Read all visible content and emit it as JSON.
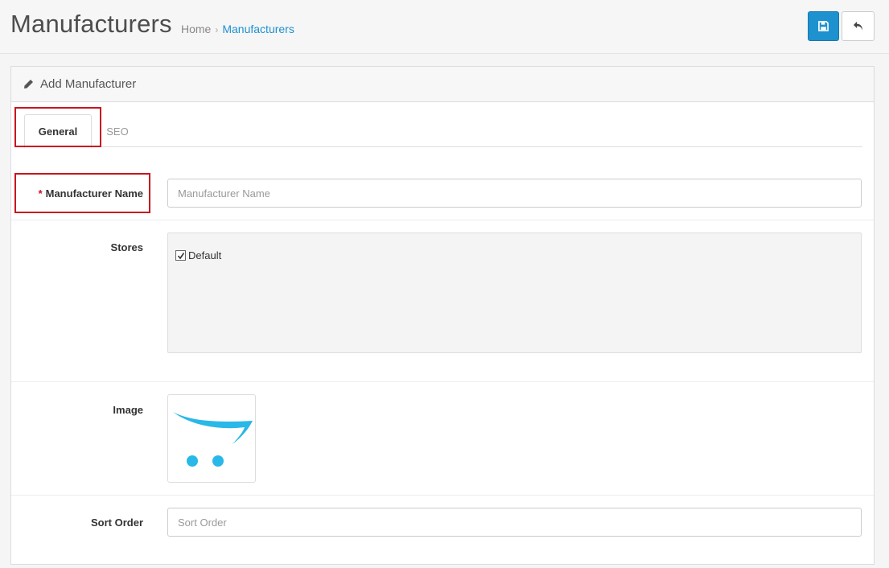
{
  "header": {
    "title": "Manufacturers",
    "breadcrumb": [
      {
        "label": "Home"
      },
      {
        "label": "Manufacturers"
      }
    ],
    "breadcrumb_separator": "›",
    "save_icon": "save-icon",
    "back_icon": "reply-icon",
    "primary_color": "#1e91cf"
  },
  "panel": {
    "title": "Add Manufacturer",
    "title_icon": "pencil-icon",
    "tabs": [
      {
        "label": "General",
        "active": true
      },
      {
        "label": "SEO",
        "active": false
      }
    ]
  },
  "form": {
    "required_marker": "*",
    "manufacturer_name": {
      "label": "Manufacturer Name",
      "value": "",
      "placeholder": "Manufacturer Name"
    },
    "stores": {
      "label": "Stores",
      "options": [
        {
          "label": "Default",
          "checked": true
        }
      ]
    },
    "image": {
      "label": "Image",
      "icon": "opencart-logo-icon"
    },
    "sort_order": {
      "label": "Sort Order",
      "value": "",
      "placeholder": "Sort Order"
    }
  },
  "highlight_color": "#c9151e"
}
